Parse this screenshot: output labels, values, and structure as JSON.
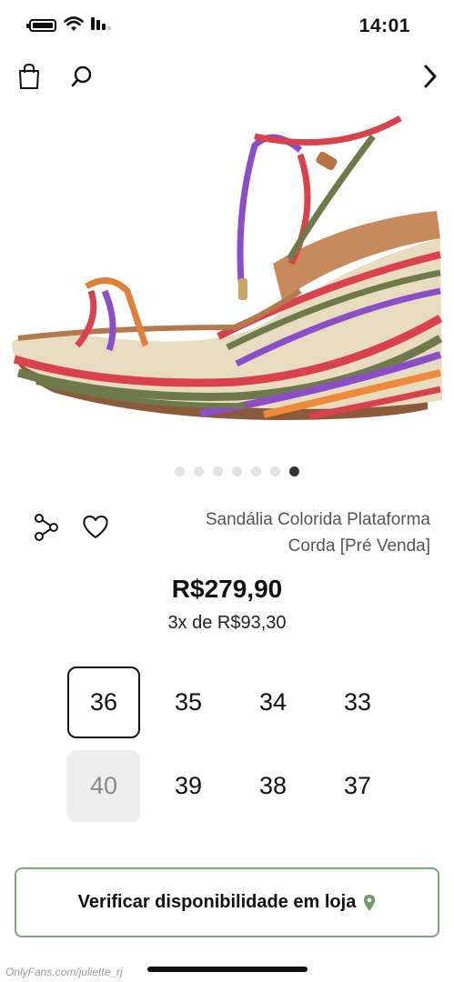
{
  "status_bar": {
    "time": "14:01"
  },
  "nav": {
    "icons": [
      "bag-icon",
      "search-icon",
      "chevron-back-icon"
    ]
  },
  "carousel": {
    "total": 7,
    "active_index": 6
  },
  "product": {
    "name_line1": "Sandália Colorida Plataforma",
    "name_line2": "Corda [Pré Venda]",
    "price": "R$279,90",
    "installments": "3x de R$93,30"
  },
  "sizes": [
    {
      "label": "33",
      "state": "available"
    },
    {
      "label": "34",
      "state": "available"
    },
    {
      "label": "35",
      "state": "available"
    },
    {
      "label": "36",
      "state": "selected"
    },
    {
      "label": "37",
      "state": "available"
    },
    {
      "label": "38",
      "state": "available"
    },
    {
      "label": "39",
      "state": "available"
    },
    {
      "label": "40",
      "state": "unavailable"
    }
  ],
  "store_button": {
    "label": "Verificar disponibilidade em loja",
    "icon": "location-pin-icon",
    "border_color": "#7fa57a"
  },
  "watermark": "OnlyFans.com/juliette_rj"
}
